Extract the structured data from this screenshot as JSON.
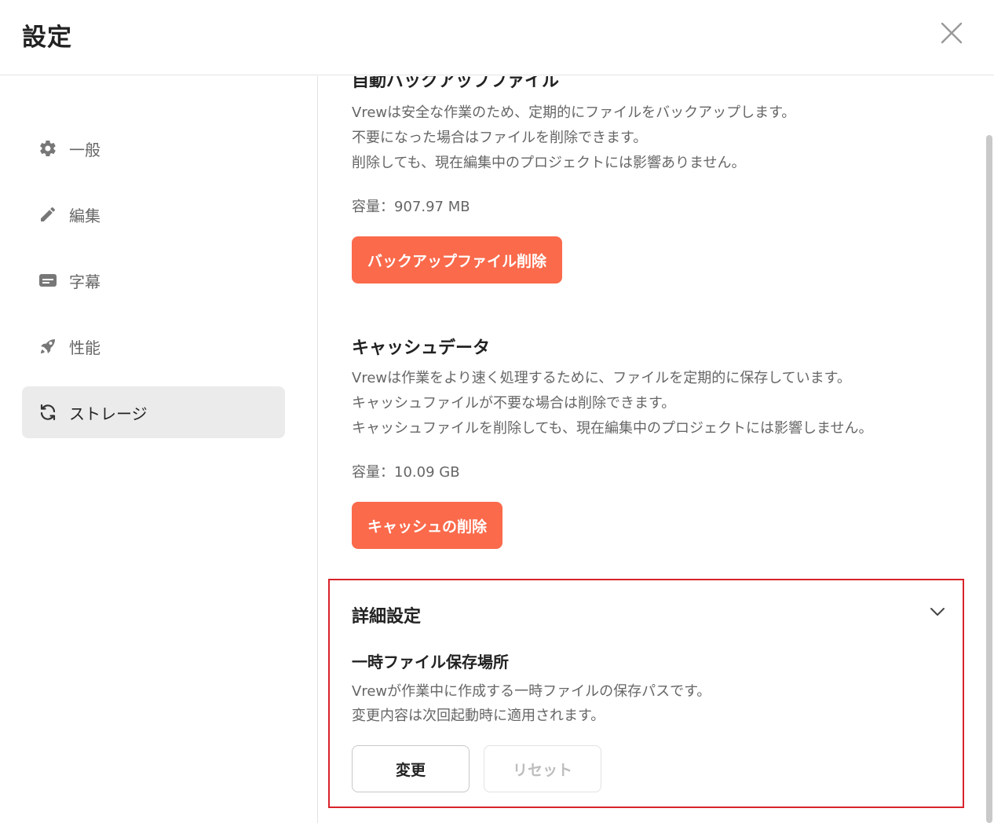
{
  "header": {
    "title": "設定",
    "close_icon": "close-icon"
  },
  "sidebar": {
    "items": [
      {
        "label": "一般",
        "icon": "gear-icon",
        "active": false
      },
      {
        "label": "編集",
        "icon": "pencil-icon",
        "active": false
      },
      {
        "label": "字幕",
        "icon": "subtitles-icon",
        "active": false
      },
      {
        "label": "性能",
        "icon": "rocket-icon",
        "active": false
      },
      {
        "label": "ストレージ",
        "icon": "sync-icon",
        "active": true
      }
    ]
  },
  "backup": {
    "title": "自動バックアップファイル",
    "desc": [
      "Vrewは安全な作業のため、定期的にファイルをバックアップします。",
      "不要になった場合はファイルを削除できます。",
      "削除しても、現在編集中のプロジェクトには影響ありません。"
    ],
    "capacity": "容量：907.97 MB",
    "delete_label": "バックアップファイル削除"
  },
  "cache": {
    "title": "キャッシュデータ",
    "desc": [
      "Vrewは作業をより速く処理するために、ファイルを定期的に保存しています。",
      "キャッシュファイルが不要な場合は削除できます。",
      "キャッシュファイルを削除しても、現在編集中のプロジェクトには影響しません。"
    ],
    "capacity": "容量：10.09 GB",
    "delete_label": "キャッシュの削除"
  },
  "advanced": {
    "title": "詳細設定",
    "temp_title": "一時ファイル保存場所",
    "temp_desc": [
      "Vrewが作業中に作成する一時ファイルの保存パスです。",
      "変更内容は次回起動時に適用されます。"
    ],
    "change_label": "変更",
    "reset_label": "リセット"
  },
  "colors": {
    "danger": "#fa6a4b",
    "highlight_border": "#d8232a",
    "active_bg": "#ebebec"
  }
}
